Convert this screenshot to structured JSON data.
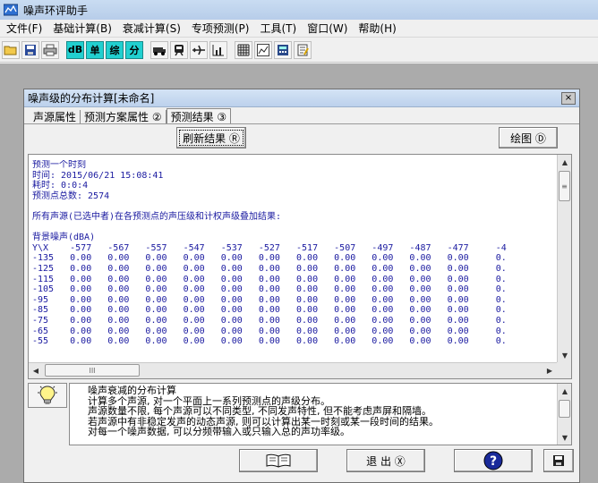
{
  "app": {
    "title": "噪声环评助手"
  },
  "menu": [
    "文件(F)",
    "基础计算(B)",
    "衰减计算(S)",
    "专项预测(P)",
    "工具(T)",
    "窗口(W)",
    "帮助(H)"
  ],
  "toolbar": {
    "icons": [
      "open-folder-icon",
      "save-disk-icon",
      "print-icon",
      "dB-button",
      "single-source-button",
      "synthesis-button",
      "distribution-button",
      "vehicle-icon",
      "train-icon",
      "aircraft-icon",
      "chart-icon",
      "grid-icon",
      "line-chart-icon",
      "calculator-icon",
      "notepad-icon"
    ],
    "labels": {
      "dB": "dB",
      "single": "单",
      "synthesis": "综",
      "distribution": "分"
    },
    "accent": "#21d0d0"
  },
  "window": {
    "title": "噪声级的分布计算[未命名]",
    "close_label": "×",
    "tabs": [
      "声源属性",
      "预测方案属性 ②",
      "预测结果 ③"
    ],
    "active_tab": 2,
    "refresh_button": "刷新结果 Ⓡ",
    "plot_button": "绘图 Ⓓ"
  },
  "results": {
    "header_lines": [
      "预测一个时刻",
      "时间: 2015/06/21 15:08:41",
      "耗时: 0:0:4",
      "预测点总数: 2574"
    ],
    "summary": "所有声源(已选中者)在各预测点的声压级和计权声级叠加结果:",
    "section_title": "背景噪声(dBA)",
    "axis_label": "Y\\X",
    "x_values": [
      "-577",
      "-567",
      "-557",
      "-547",
      "-537",
      "-527",
      "-517",
      "-507",
      "-497",
      "-487",
      "-477",
      "-4"
    ],
    "rows": [
      {
        "y": "-135",
        "cells": [
          "0.00",
          "0.00",
          "0.00",
          "0.00",
          "0.00",
          "0.00",
          "0.00",
          "0.00",
          "0.00",
          "0.00",
          "0.00",
          "0."
        ]
      },
      {
        "y": "-125",
        "cells": [
          "0.00",
          "0.00",
          "0.00",
          "0.00",
          "0.00",
          "0.00",
          "0.00",
          "0.00",
          "0.00",
          "0.00",
          "0.00",
          "0."
        ]
      },
      {
        "y": "-115",
        "cells": [
          "0.00",
          "0.00",
          "0.00",
          "0.00",
          "0.00",
          "0.00",
          "0.00",
          "0.00",
          "0.00",
          "0.00",
          "0.00",
          "0."
        ]
      },
      {
        "y": "-105",
        "cells": [
          "0.00",
          "0.00",
          "0.00",
          "0.00",
          "0.00",
          "0.00",
          "0.00",
          "0.00",
          "0.00",
          "0.00",
          "0.00",
          "0."
        ]
      },
      {
        "y": "-95",
        "cells": [
          "0.00",
          "0.00",
          "0.00",
          "0.00",
          "0.00",
          "0.00",
          "0.00",
          "0.00",
          "0.00",
          "0.00",
          "0.00",
          "0."
        ]
      },
      {
        "y": "-85",
        "cells": [
          "0.00",
          "0.00",
          "0.00",
          "0.00",
          "0.00",
          "0.00",
          "0.00",
          "0.00",
          "0.00",
          "0.00",
          "0.00",
          "0."
        ]
      },
      {
        "y": "-75",
        "cells": [
          "0.00",
          "0.00",
          "0.00",
          "0.00",
          "0.00",
          "0.00",
          "0.00",
          "0.00",
          "0.00",
          "0.00",
          "0.00",
          "0."
        ]
      },
      {
        "y": "-65",
        "cells": [
          "0.00",
          "0.00",
          "0.00",
          "0.00",
          "0.00",
          "0.00",
          "0.00",
          "0.00",
          "0.00",
          "0.00",
          "0.00",
          "0."
        ]
      },
      {
        "y": "-55",
        "cells": [
          "0.00",
          "0.00",
          "0.00",
          "0.00",
          "0.00",
          "0.00",
          "0.00",
          "0.00",
          "0.00",
          "0.00",
          "0.00",
          "0."
        ]
      }
    ],
    "text_color": "#1a1aa0",
    "hscroll_thumb": "III",
    "vscroll_thumb": "≡"
  },
  "hint": {
    "lines": [
      "噪声衰减的分布计算",
      "计算多个声源, 对一个平面上一系列预测点的声级分布。",
      "声源数量不限, 每个声源可以不同类型, 不同发声特性, 但不能考虑声屏和隔墙。",
      "若声源中有非稳定发声的动态声源, 则可以计算出某一时刻或某一段时间的结果。",
      "对每一个噪声数据, 可以分频带输入或只输入总的声功率级。"
    ]
  },
  "bottom_buttons": {
    "exit_label": "退 出 Ⓧ"
  }
}
